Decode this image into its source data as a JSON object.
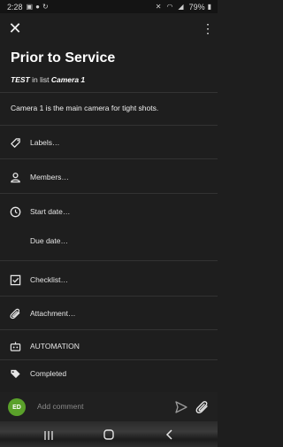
{
  "status_bar": {
    "time": "2:28",
    "battery": "79%"
  },
  "app_bar": {
    "close_label": "✕",
    "more_label": "⋮"
  },
  "card": {
    "title": "Prior to Service",
    "board": "TEST",
    "in_list_text": "in list",
    "list": "Camera 1",
    "description": "Camera 1 is the main camera for tight shots."
  },
  "fields": [
    {
      "icon": "label-tag-icon",
      "label": "Labels…"
    },
    {
      "icon": "member-person-icon",
      "label": "Members…"
    },
    {
      "icon": "clock-icon",
      "label": "Start date…"
    },
    {
      "icon": "",
      "label": "Due date…"
    },
    {
      "icon": "checklist-icon",
      "label": "Checklist…"
    },
    {
      "icon": "paperclip-icon",
      "label": "Attachment…"
    },
    {
      "icon": "automation-robot-icon",
      "label": "AUTOMATION"
    },
    {
      "icon": "tag-filled-icon",
      "label": "Completed"
    }
  ],
  "comment": {
    "avatar_initials": "ED",
    "avatar_color": "#5aa12a",
    "placeholder": "Add comment"
  },
  "colors": {
    "background": "#1e1e1e",
    "accent_avatar": "#5aa12a"
  }
}
